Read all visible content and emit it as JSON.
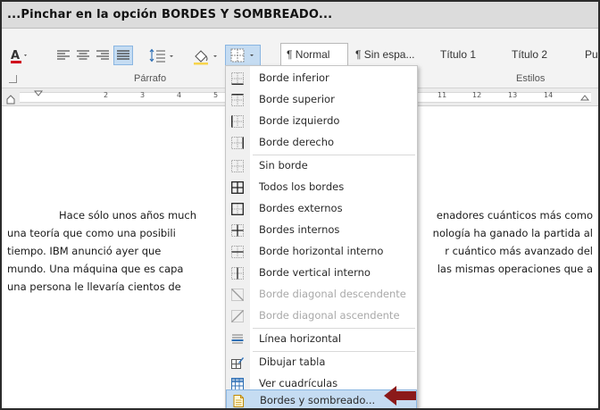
{
  "caption": "...Pinchar en la opción BORDES Y SOMBREADO...",
  "ribbon": {
    "styles": [
      "¶ Normal",
      "¶ Sin espa...",
      "Título 1",
      "Título 2",
      "Pu"
    ],
    "groups": {
      "paragraph": "Párrafo",
      "styles": "Estilos"
    }
  },
  "ruler": {
    "left_numbers": [
      "2",
      "3",
      "4",
      "5"
    ],
    "right_numbers": [
      "11",
      "12",
      "13",
      "14"
    ]
  },
  "document": {
    "lines": [
      {
        "left": "Hace sólo unos años much",
        "right": "enadores cuánticos más como"
      },
      {
        "left": "una teoría que como una posibili",
        "right": "nología ha ganado la partida al"
      },
      {
        "left": "tiempo. IBM anunció ayer que",
        "right": "r cuántico más avanzado del"
      },
      {
        "left": "mundo. Una máquina que es capa",
        "right": "las mismas operaciones que a"
      },
      {
        "left": "una persona le llevaría cientos de",
        "right": ""
      }
    ]
  },
  "borders_menu": {
    "items": [
      {
        "label": "Borde inferior",
        "icon": "border-bottom-icon",
        "enabled": true
      },
      {
        "label": "Borde superior",
        "icon": "border-top-icon",
        "enabled": true
      },
      {
        "label": "Borde izquierdo",
        "icon": "border-left-icon",
        "enabled": true
      },
      {
        "label": "Borde derecho",
        "icon": "border-right-icon",
        "enabled": true
      },
      {
        "label": "Sin borde",
        "icon": "no-border-icon",
        "enabled": true
      },
      {
        "label": "Todos los bordes",
        "icon": "all-borders-icon",
        "enabled": true
      },
      {
        "label": "Bordes externos",
        "icon": "outside-borders-icon",
        "enabled": true
      },
      {
        "label": "Bordes internos",
        "icon": "inside-borders-icon",
        "enabled": true
      },
      {
        "label": "Borde horizontal interno",
        "icon": "inside-horizontal-border-icon",
        "enabled": true
      },
      {
        "label": "Borde vertical interno",
        "icon": "inside-vertical-border-icon",
        "enabled": true
      },
      {
        "label": "Borde diagonal descendente",
        "icon": "diagonal-down-border-icon",
        "enabled": false
      },
      {
        "label": "Borde diagonal ascendente",
        "icon": "diagonal-up-border-icon",
        "enabled": false
      },
      {
        "label": "Línea horizontal",
        "icon": "horizontal-line-icon",
        "enabled": true
      },
      {
        "label": "Dibujar tabla",
        "icon": "draw-table-icon",
        "enabled": true
      },
      {
        "label": "Ver cuadrículas",
        "icon": "view-gridlines-icon",
        "enabled": true
      },
      {
        "label": "Bordes y sombreado...",
        "icon": "borders-shading-icon",
        "enabled": true,
        "selected": true
      }
    ]
  },
  "colors": {
    "accent_arrow": "#8b1a1a",
    "selected_bg": "#c5dcf2",
    "font_color_red": "#d0021b"
  }
}
